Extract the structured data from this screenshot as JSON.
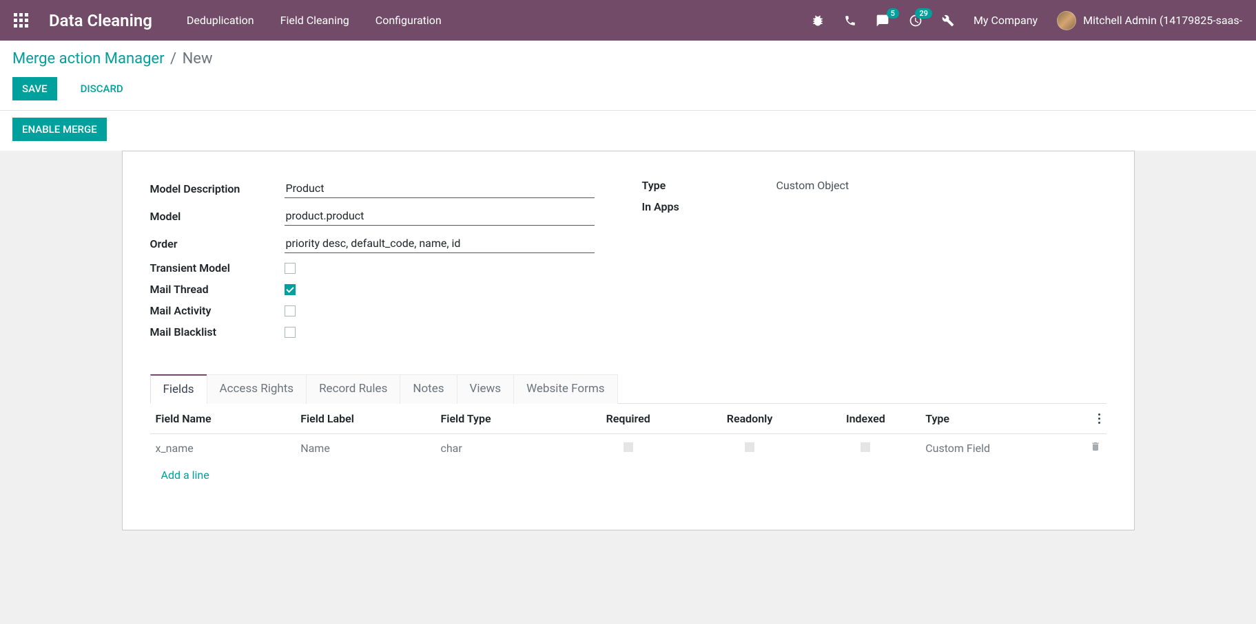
{
  "navbar": {
    "brand": "Data Cleaning",
    "links": {
      "deduplication": "Deduplication",
      "field_cleaning": "Field Cleaning",
      "configuration": "Configuration"
    },
    "badges": {
      "messages": "5",
      "activities": "29"
    },
    "company": "My Company",
    "user": "Mitchell Admin (14179825-saas-"
  },
  "breadcrumb": {
    "parent": "Merge action Manager",
    "current": "New"
  },
  "buttons": {
    "save": "SAVE",
    "discard": "DISCARD",
    "enable_merge": "ENABLE MERGE"
  },
  "form": {
    "labels": {
      "model_description": "Model Description",
      "model": "Model",
      "order": "Order",
      "transient": "Transient Model",
      "mail_thread": "Mail Thread",
      "mail_activity": "Mail Activity",
      "mail_blacklist": "Mail Blacklist",
      "type": "Type",
      "in_apps": "In Apps"
    },
    "values": {
      "model_description": "Product",
      "model": "product.product",
      "order": "priority desc, default_code, name, id",
      "type": "Custom Object"
    },
    "checkboxes": {
      "transient": false,
      "mail_thread": true,
      "mail_activity": false,
      "mail_blacklist": false
    }
  },
  "tabs": {
    "fields": "Fields",
    "access_rights": "Access Rights",
    "record_rules": "Record Rules",
    "notes": "Notes",
    "views": "Views",
    "website_forms": "Website Forms"
  },
  "table": {
    "headers": {
      "field_name": "Field Name",
      "field_label": "Field Label",
      "field_type": "Field Type",
      "required": "Required",
      "readonly": "Readonly",
      "indexed": "Indexed",
      "type": "Type"
    },
    "rows": [
      {
        "field_name": "x_name",
        "field_label": "Name",
        "field_type": "char",
        "type": "Custom Field"
      }
    ],
    "add_line": "Add a line"
  }
}
